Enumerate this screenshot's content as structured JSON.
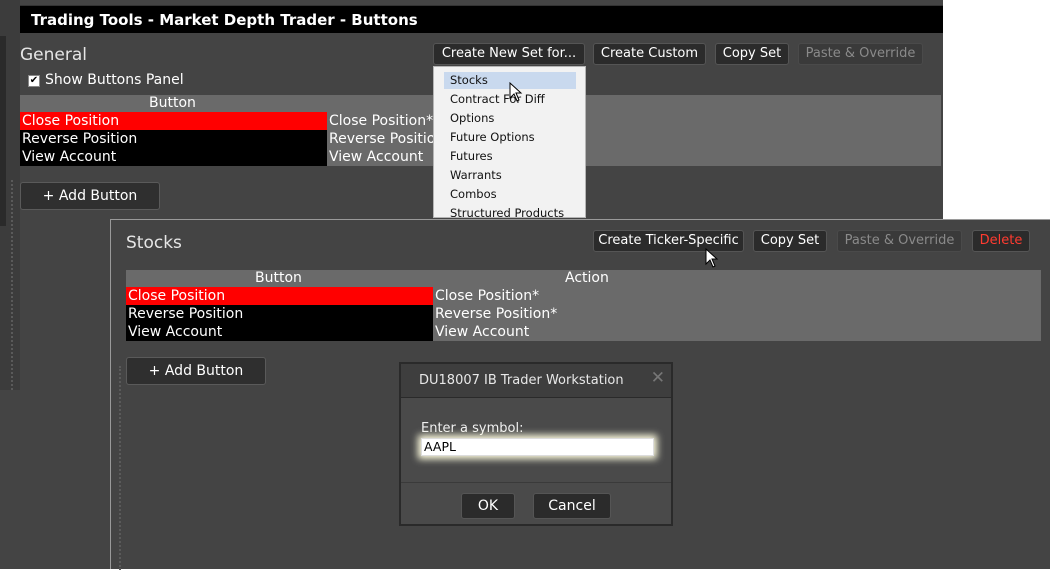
{
  "back_window": {
    "title": "Trading Tools - Market Depth Trader - Buttons",
    "section_title": "General",
    "toolbar": {
      "create_new_set": "Create New Set for...",
      "create_custom": "Create Custom",
      "copy_set": "Copy Set",
      "paste_override": "Paste & Override"
    },
    "show_buttons_panel": {
      "label": "Show Buttons Panel",
      "checked": true
    },
    "table": {
      "header_button": "Button",
      "rows": [
        {
          "button": "Close Position",
          "action": "Close Position*"
        },
        {
          "button": "Reverse Position",
          "action": "Reverse Positio"
        },
        {
          "button": "View Account",
          "action": "View Account"
        }
      ]
    },
    "add_button": "+ Add Button"
  },
  "dropdown": {
    "items": [
      "Stocks",
      "Contract For Diff",
      "Options",
      "Future Options",
      "Futures",
      "Warrants",
      "Combos",
      "Structured Products"
    ],
    "highlighted": "Stocks"
  },
  "front_window": {
    "section_title": "Stocks",
    "toolbar": {
      "create_ticker_specific": "Create Ticker-Specific",
      "copy_set": "Copy Set",
      "paste_override": "Paste & Override",
      "delete": "Delete"
    },
    "table": {
      "header_button": "Button",
      "header_action": "Action",
      "rows": [
        {
          "button": "Close Position",
          "action": "Close Position*"
        },
        {
          "button": "Reverse Position",
          "action": "Reverse Position*"
        },
        {
          "button": "View Account",
          "action": "View Account"
        }
      ]
    },
    "add_button": "+ Add Button"
  },
  "dialog": {
    "title": "DU18007 IB Trader Workstation",
    "close_glyph": "✕",
    "prompt": "Enter a symbol:",
    "input_value": "AAPL",
    "ok": "OK",
    "cancel": "Cancel"
  },
  "colors": {
    "panel_bg": "#444444",
    "title_bar": "#000000",
    "selected_row": "#ff0000",
    "delete_text": "#ff3b30",
    "dropdown_highlight": "#c9d9ee"
  }
}
